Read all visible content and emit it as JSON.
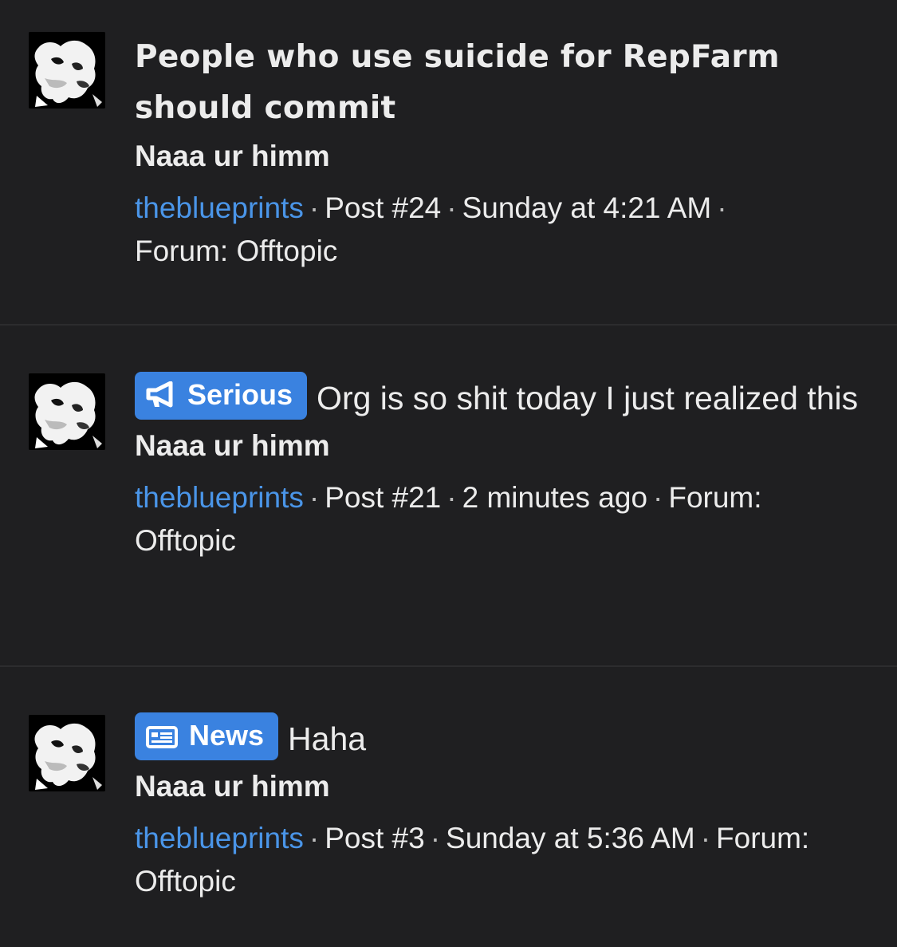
{
  "posts": [
    {
      "title": "People who use suicide for RepFarm should commit",
      "prefix": null,
      "thread_author": "Naaa ur himm",
      "user": "theblueprints",
      "post_number": "Post #24",
      "time": "Sunday at 4:21 AM",
      "forum": "Forum: Offtopic"
    },
    {
      "title": "Org is so shit today I just realized this",
      "prefix": {
        "label": "Serious",
        "icon": "megaphone-icon"
      },
      "thread_author": "Naaa ur himm",
      "user": "theblueprints",
      "post_number": "Post #21",
      "time": "2 minutes ago",
      "forum": "Forum: Offtopic"
    },
    {
      "title": "Haha",
      "prefix": {
        "label": "News",
        "icon": "newspaper-icon"
      },
      "thread_author": "Naaa ur himm",
      "user": "theblueprints",
      "post_number": "Post #3",
      "time": "Sunday at 5:36 AM",
      "forum": "Forum: Offtopic"
    }
  ],
  "separator": "·",
  "colors": {
    "background": "#1f1f21",
    "divider": "#2c2c2e",
    "link": "#4a95e8",
    "prefix_bg": "#3a82e0",
    "text": "#ececec"
  }
}
